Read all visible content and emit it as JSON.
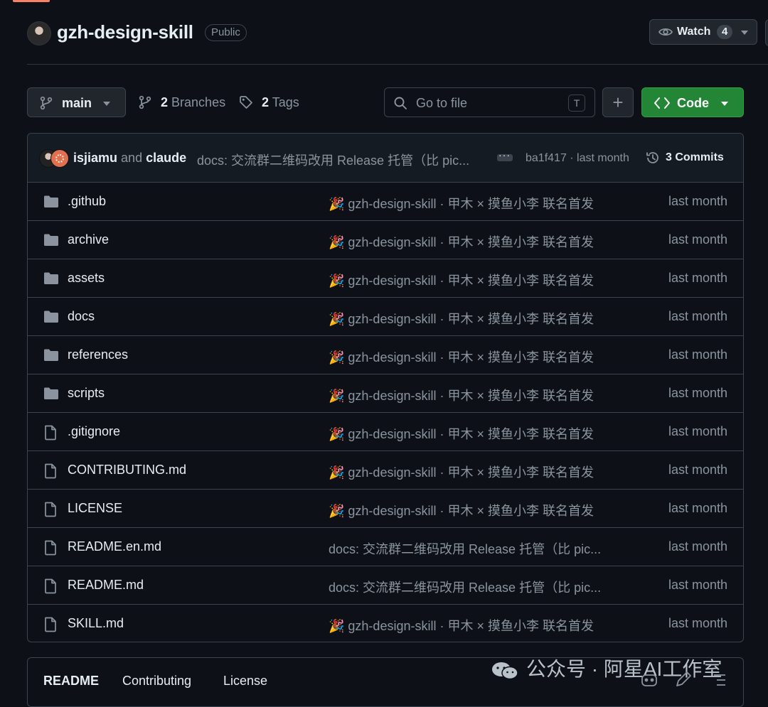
{
  "repo": {
    "name": "gzh-design-skill",
    "visibility": "Public",
    "watch_label": "Watch",
    "watch_count": "4"
  },
  "toolbar": {
    "branch": "main",
    "branches_count": "2",
    "branches_label": "Branches",
    "tags_count": "2",
    "tags_label": "Tags",
    "search_placeholder": "Go to file",
    "search_shortcut": "T",
    "add_label": "+",
    "code_label": "Code"
  },
  "latest_commit": {
    "author1": "isjiamu",
    "and": "and",
    "author2": "claude",
    "message": "docs: 交流群二维码改用 Release 托管（比 pic...",
    "meta": "ba1f417 · last month",
    "commits_label": "3 Commits"
  },
  "files": [
    {
      "type": "folder",
      "name": ".github",
      "message": "🎉 gzh-design-skill · 甲木 × 摸鱼小李 联名首发",
      "age": "last month"
    },
    {
      "type": "folder",
      "name": "archive",
      "message": "🎉 gzh-design-skill · 甲木 × 摸鱼小李 联名首发",
      "age": "last month"
    },
    {
      "type": "folder",
      "name": "assets",
      "message": "🎉 gzh-design-skill · 甲木 × 摸鱼小李 联名首发",
      "age": "last month"
    },
    {
      "type": "folder",
      "name": "docs",
      "message": "🎉 gzh-design-skill · 甲木 × 摸鱼小李 联名首发",
      "age": "last month"
    },
    {
      "type": "folder",
      "name": "references",
      "message": "🎉 gzh-design-skill · 甲木 × 摸鱼小李 联名首发",
      "age": "last month"
    },
    {
      "type": "folder",
      "name": "scripts",
      "message": "🎉 gzh-design-skill · 甲木 × 摸鱼小李 联名首发",
      "age": "last month"
    },
    {
      "type": "file",
      "name": ".gitignore",
      "message": "🎉 gzh-design-skill · 甲木 × 摸鱼小李 联名首发",
      "age": "last month"
    },
    {
      "type": "file",
      "name": "CONTRIBUTING.md",
      "message": "🎉 gzh-design-skill · 甲木 × 摸鱼小李 联名首发",
      "age": "last month"
    },
    {
      "type": "file",
      "name": "LICENSE",
      "message": "🎉 gzh-design-skill · 甲木 × 摸鱼小李 联名首发",
      "age": "last month"
    },
    {
      "type": "file",
      "name": "README.en.md",
      "message": "docs: 交流群二维码改用 Release 托管（比 pic...",
      "age": "last month"
    },
    {
      "type": "file",
      "name": "README.md",
      "message": "docs: 交流群二维码改用 Release 托管（比 pic...",
      "age": "last month"
    },
    {
      "type": "file",
      "name": "SKILL.md",
      "message": "🎉 gzh-design-skill · 甲木 × 摸鱼小李 联名首发",
      "age": "last month"
    }
  ],
  "readme_tabs": [
    "README",
    "Contributing",
    "License"
  ],
  "watermark": "公众号 · 阿星AI工作室",
  "icons": {
    "folder": "folder-icon",
    "file": "file-icon"
  },
  "colors": {
    "background": "#0d1117",
    "border": "#3d444d",
    "text": "#e6edf3",
    "muted": "#8b949e",
    "code_button": "#238636"
  }
}
